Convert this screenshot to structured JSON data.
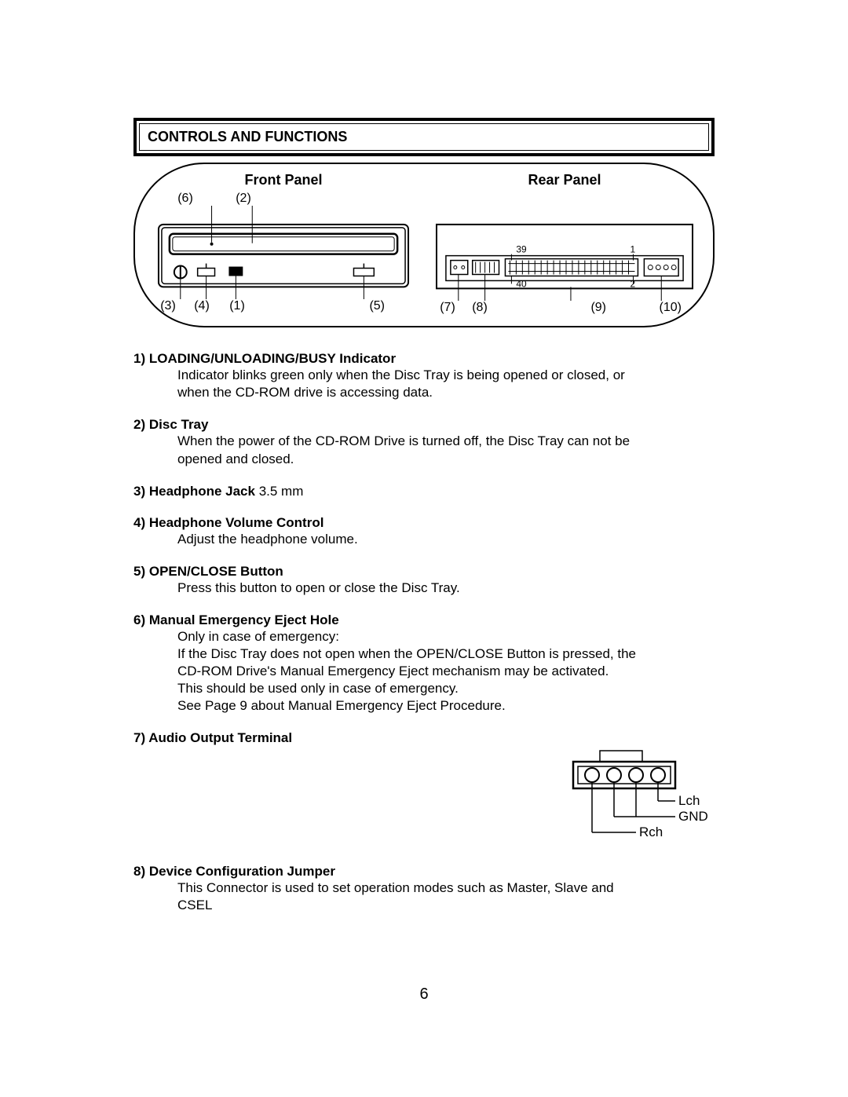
{
  "section_title": "CONTROLS AND FUNCTIONS",
  "panels": {
    "front": {
      "title": "Front Panel",
      "top_callouts": [
        "(6)",
        "(2)"
      ],
      "bottom_callouts": [
        "(3)",
        "(4)",
        "(1)",
        "(5)"
      ]
    },
    "rear": {
      "title": "Rear Panel",
      "pin_labels": {
        "tl": "39",
        "tr": "1",
        "bl": "40",
        "br": "2"
      },
      "bottom_callouts": [
        "(7)",
        "(8)",
        "(9)",
        "(10)"
      ]
    }
  },
  "items": [
    {
      "num": "1)",
      "title": "LOADING/UNLOADING/BUSY Indicator",
      "suffix": "",
      "lines": [
        "Indicator blinks green only when the Disc Tray is being opened or closed, or when the CD-ROM drive is accessing data."
      ]
    },
    {
      "num": "2)",
      "title": "Disc Tray",
      "suffix": "",
      "lines": [
        "When the power of the CD-ROM Drive is turned off, the Disc Tray can not be opened and closed."
      ]
    },
    {
      "num": "3)",
      "title": "Headphone Jack",
      "suffix": " 3.5 mm",
      "lines": []
    },
    {
      "num": "4)",
      "title": "Headphone Volume Control",
      "suffix": "",
      "lines": [
        "Adjust the headphone volume."
      ]
    },
    {
      "num": "5)",
      "title": "OPEN/CLOSE Button",
      "suffix": "",
      "lines": [
        "Press this button to open or close the Disc Tray."
      ]
    },
    {
      "num": "6)",
      "title": "Manual Emergency Eject Hole",
      "suffix": "",
      "lines": [
        "Only in case of emergency:",
        "If the Disc Tray does not open when the OPEN/CLOSE Button is pressed, the CD-ROM Drive's Manual Emergency Eject mechanism may be activated.",
        "This should be used only in case of emergency.",
        "See Page 9 about Manual Emergency Eject Procedure."
      ]
    },
    {
      "num": "7)",
      "title": "Audio Output Terminal",
      "suffix": "",
      "lines": []
    },
    {
      "num": "8)",
      "title": "Device Configuration Jumper",
      "suffix": "",
      "lines": [
        "This Connector is used to set operation modes such as Master, Slave and CSEL"
      ]
    }
  ],
  "audio_pins": {
    "lch": "Lch",
    "gnd": "GND",
    "rch": "Rch"
  },
  "page_number": "6"
}
